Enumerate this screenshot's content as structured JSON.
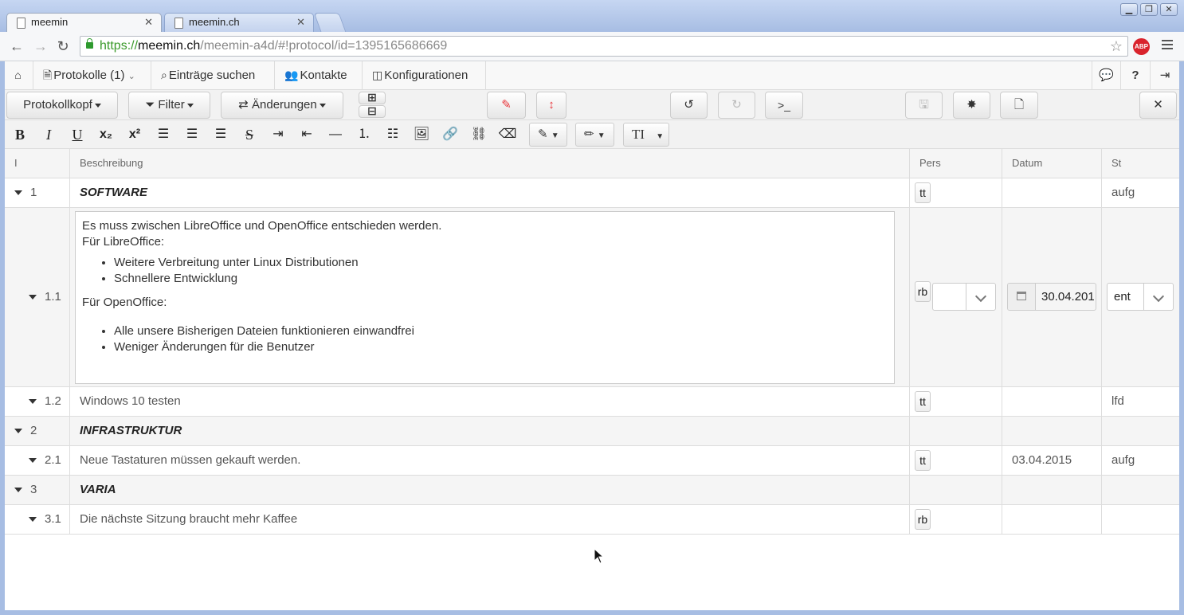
{
  "browser": {
    "tabs": [
      {
        "title": "meemin",
        "active": true
      },
      {
        "title": "meemin.ch",
        "active": false
      }
    ],
    "url": {
      "scheme": "https://",
      "host": "meemin.ch",
      "path": "/meemin-a4d/#!protocol/id=1395165686669"
    },
    "extension_label": "ABP"
  },
  "appnav": {
    "protokolle": "Protokolle (1)",
    "eintraege": "Einträge suchen",
    "kontakte": "Kontakte",
    "konfigurationen": "Konfigurationen"
  },
  "toolbar": {
    "protokollkopf": "Protokollkopf",
    "filter": "Filter",
    "aenderungen": "Änderungen",
    "terminal": ">_"
  },
  "format": {
    "bold": "B",
    "italic": "I",
    "underline": "U",
    "subscript": "x₂",
    "superscript": "x²",
    "hr": "—",
    "font_size": "TI"
  },
  "table": {
    "headers": {
      "nr": "I",
      "desc": "Beschreibung",
      "pers": "Pers",
      "date": "Datum",
      "st": "St"
    },
    "rows": [
      {
        "nr": "1",
        "desc": "SOFTWARE",
        "pers": "tt",
        "date": "",
        "st": "aufg"
      },
      {
        "nr": "1.1",
        "pers": "rb",
        "date": "30.04.201",
        "st": "ent",
        "editor": {
          "p1": "Es muss zwischen LibreOffice und OpenOffice entschieden werden.",
          "p2": "Für LibreOffice:",
          "list1": [
            "Weitere Verbreitung unter Linux Distributionen",
            "Schnellere Entwicklung"
          ],
          "p3": "Für OpenOffice:",
          "list2": [
            "Alle unsere Bisherigen Dateien funktionieren einwandfrei",
            "Weniger Änderungen für die Benutzer"
          ]
        }
      },
      {
        "nr": "1.2",
        "desc": "Windows 10 testen",
        "pers": "tt",
        "date": "",
        "st": "lfd"
      },
      {
        "nr": "2",
        "desc": "INFRASTRUKTUR",
        "pers": "",
        "date": "",
        "st": ""
      },
      {
        "nr": "2.1",
        "desc": "Neue Tastaturen müssen gekauft werden.",
        "pers": "tt",
        "date": "03.04.2015",
        "st": "aufg"
      },
      {
        "nr": "3",
        "desc": "VARIA",
        "pers": "",
        "date": "",
        "st": ""
      },
      {
        "nr": "3.1",
        "desc": "Die nächste Sitzung braucht mehr Kaffee",
        "pers": "rb",
        "date": "",
        "st": ""
      }
    ]
  },
  "colors": {
    "edit_red": "#e8353a",
    "url_green": "#3a9a2a",
    "abp_red": "#d9232d"
  }
}
